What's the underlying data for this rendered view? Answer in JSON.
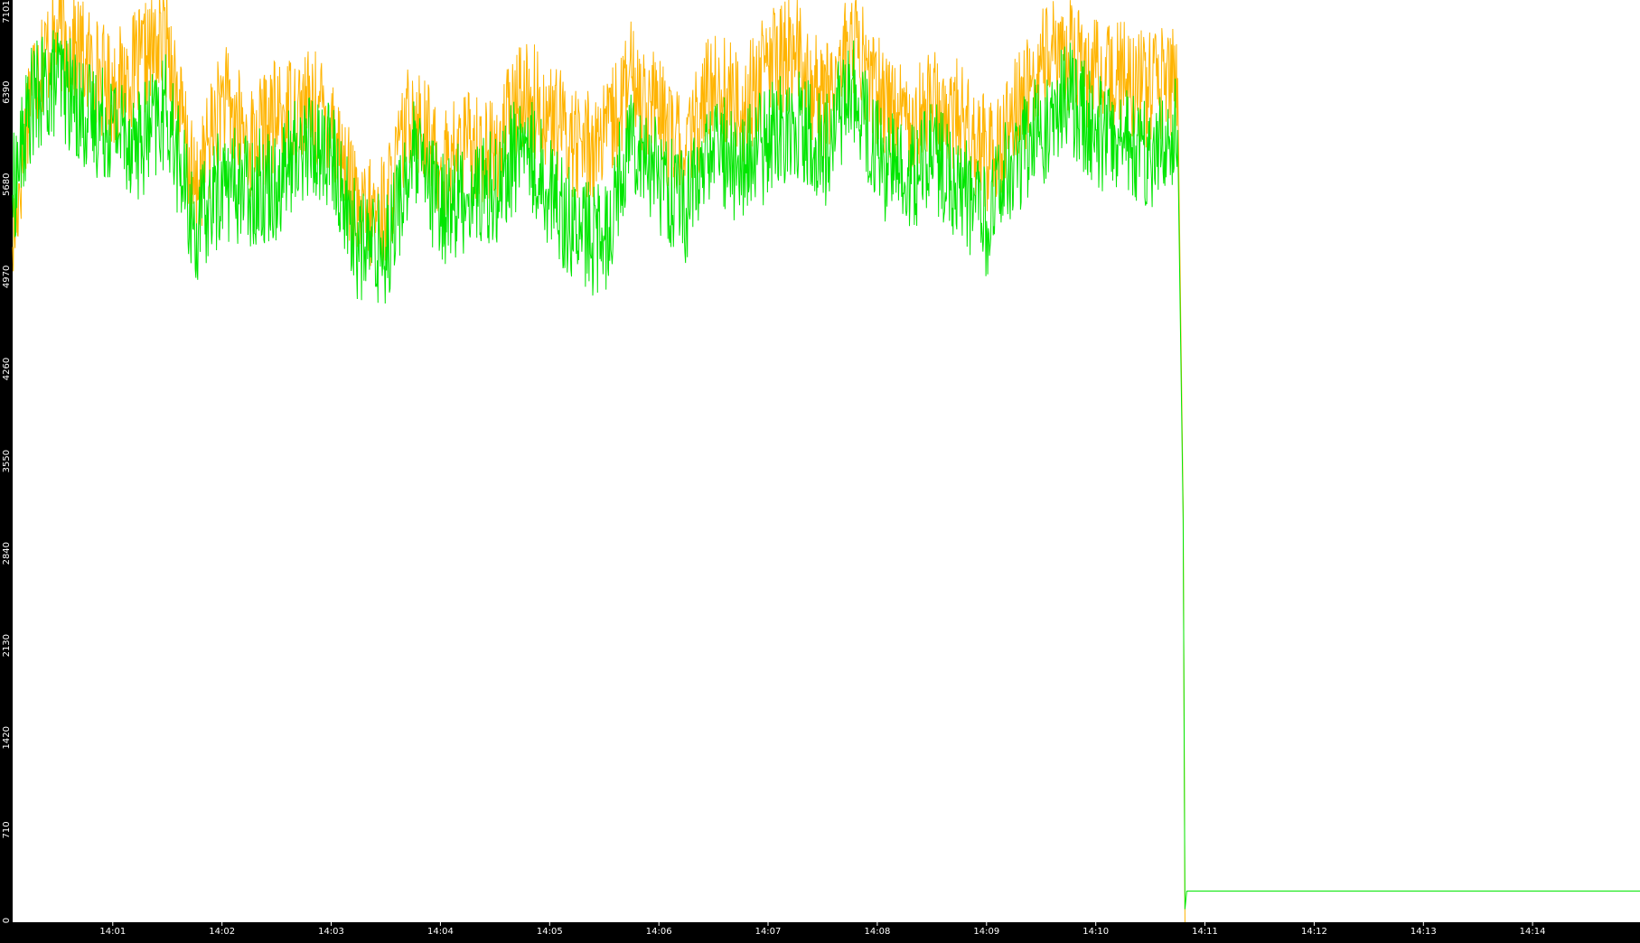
{
  "colors": {
    "background": "#000000",
    "plot_background": "#ffffff",
    "axis_text": "#ffffff"
  },
  "chart_data": {
    "type": "line",
    "title": "",
    "xlabel": "",
    "ylabel": "",
    "ylim": [
      0,
      7101
    ],
    "y_tick_labels": [
      "0",
      "710",
      "1420",
      "2130",
      "2840",
      "3550",
      "4260",
      "4970",
      "5680",
      "6390",
      "7101"
    ],
    "x_range": [
      "14:00:05",
      "14:14:59"
    ],
    "x_tick_labels": [
      "14:01",
      "14:02",
      "14:03",
      "14:04",
      "14:05",
      "14:06",
      "14:07",
      "14:08",
      "14:09",
      "14:10",
      "14:11",
      "14:12",
      "14:13",
      "14:14"
    ],
    "grid": false,
    "legend": "none",
    "series": [
      {
        "color": "#ffb400",
        "points": [
          [
            "14:00:05",
            5200
          ],
          [
            "14:00:15",
            6500
          ],
          [
            "14:00:30",
            6850
          ],
          [
            "14:00:45",
            6650
          ],
          [
            "14:01:00",
            6400
          ],
          [
            "14:01:15",
            6600
          ],
          [
            "14:01:30",
            6800
          ],
          [
            "14:01:45",
            5600
          ],
          [
            "14:02:00",
            6350
          ],
          [
            "14:02:15",
            6000
          ],
          [
            "14:02:30",
            6200
          ],
          [
            "14:02:45",
            6300
          ],
          [
            "14:03:00",
            6200
          ],
          [
            "14:03:15",
            5400
          ],
          [
            "14:03:30",
            5500
          ],
          [
            "14:03:45",
            6300
          ],
          [
            "14:04:00",
            5800
          ],
          [
            "14:04:15",
            6000
          ],
          [
            "14:04:30",
            5900
          ],
          [
            "14:04:45",
            6400
          ],
          [
            "14:05:00",
            6200
          ],
          [
            "14:05:15",
            6000
          ],
          [
            "14:05:30",
            6000
          ],
          [
            "14:05:45",
            6500
          ],
          [
            "14:06:00",
            6200
          ],
          [
            "14:06:15",
            5900
          ],
          [
            "14:06:30",
            6500
          ],
          [
            "14:06:45",
            6250
          ],
          [
            "14:07:00",
            6600
          ],
          [
            "14:07:15",
            6700
          ],
          [
            "14:07:30",
            6300
          ],
          [
            "14:07:45",
            6800
          ],
          [
            "14:08:00",
            6400
          ],
          [
            "14:08:15",
            6200
          ],
          [
            "14:08:30",
            6300
          ],
          [
            "14:08:45",
            6200
          ],
          [
            "14:09:00",
            5900
          ],
          [
            "14:09:15",
            6200
          ],
          [
            "14:09:30",
            6600
          ],
          [
            "14:09:45",
            6700
          ],
          [
            "14:10:00",
            6500
          ],
          [
            "14:10:15",
            6500
          ],
          [
            "14:10:30",
            6400
          ],
          [
            "14:10:45",
            6500
          ],
          [
            "14:10:48",
            3200
          ],
          [
            "14:10:49",
            0
          ]
        ]
      },
      {
        "color": "#00e600",
        "points": [
          [
            "14:00:05",
            5600
          ],
          [
            "14:00:15",
            6300
          ],
          [
            "14:00:30",
            6500
          ],
          [
            "14:00:45",
            6200
          ],
          [
            "14:01:00",
            6150
          ],
          [
            "14:01:15",
            6000
          ],
          [
            "14:01:30",
            6250
          ],
          [
            "14:01:45",
            5300
          ],
          [
            "14:02:00",
            5700
          ],
          [
            "14:02:15",
            5650
          ],
          [
            "14:02:30",
            5700
          ],
          [
            "14:02:45",
            6000
          ],
          [
            "14:03:00",
            5900
          ],
          [
            "14:03:15",
            5200
          ],
          [
            "14:03:30",
            5200
          ],
          [
            "14:03:45",
            5900
          ],
          [
            "14:04:00",
            5500
          ],
          [
            "14:04:15",
            5600
          ],
          [
            "14:04:30",
            5650
          ],
          [
            "14:04:45",
            6000
          ],
          [
            "14:05:00",
            5650
          ],
          [
            "14:05:15",
            5300
          ],
          [
            "14:05:30",
            5250
          ],
          [
            "14:05:45",
            6100
          ],
          [
            "14:06:00",
            5750
          ],
          [
            "14:06:15",
            5500
          ],
          [
            "14:06:30",
            6000
          ],
          [
            "14:06:45",
            5800
          ],
          [
            "14:07:00",
            6000
          ],
          [
            "14:07:15",
            6200
          ],
          [
            "14:07:30",
            5900
          ],
          [
            "14:07:45",
            6450
          ],
          [
            "14:08:00",
            5900
          ],
          [
            "14:08:15",
            5700
          ],
          [
            "14:08:30",
            5900
          ],
          [
            "14:08:45",
            5650
          ],
          [
            "14:09:00",
            5400
          ],
          [
            "14:09:15",
            5850
          ],
          [
            "14:09:30",
            6100
          ],
          [
            "14:09:45",
            6350
          ],
          [
            "14:10:00",
            6100
          ],
          [
            "14:10:15",
            6000
          ],
          [
            "14:10:30",
            5900
          ],
          [
            "14:10:45",
            6100
          ],
          [
            "14:10:48",
            3100
          ],
          [
            "14:10:49",
            100
          ],
          [
            "14:10:50",
            240
          ],
          [
            "14:14:59",
            240
          ]
        ]
      }
    ]
  }
}
